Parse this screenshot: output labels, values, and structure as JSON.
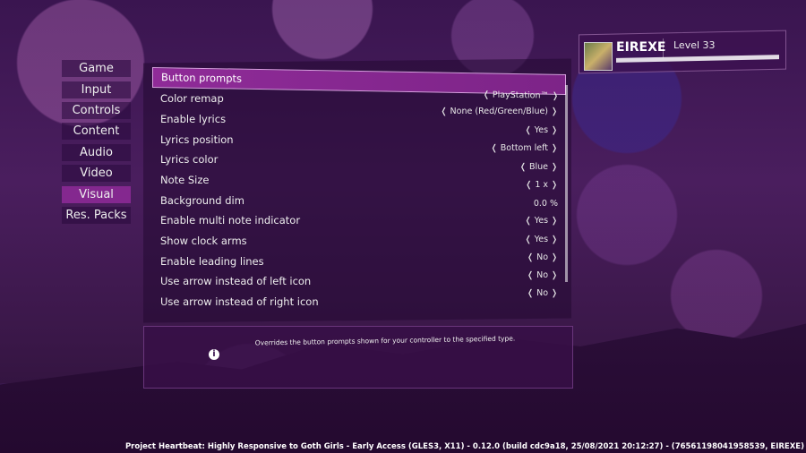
{
  "tabs": [
    {
      "label": "Game"
    },
    {
      "label": "Input"
    },
    {
      "label": "Controls"
    },
    {
      "label": "Content"
    },
    {
      "label": "Audio"
    },
    {
      "label": "Video"
    },
    {
      "label": "Visual",
      "active": true
    },
    {
      "label": "Res. Packs"
    }
  ],
  "settings": [
    {
      "label": "Button prompts",
      "value": "❬ PlayStation™ ❭",
      "selected": true
    },
    {
      "label": "Color remap",
      "value": "❬ None (Red/Green/Blue) ❭"
    },
    {
      "label": "Enable lyrics",
      "value": "❬ Yes ❭"
    },
    {
      "label": "Lyrics position",
      "value": "❬ Bottom left ❭"
    },
    {
      "label": "Lyrics color",
      "value": "❬ Blue ❭"
    },
    {
      "label": "Note Size",
      "value": "❬ 1 x ❭"
    },
    {
      "label": "Background dim",
      "value": "0.0 %"
    },
    {
      "label": "Enable multi note indicator",
      "value": "❬ Yes ❭"
    },
    {
      "label": "Show clock arms",
      "value": "❬ Yes ❭"
    },
    {
      "label": "Enable leading lines",
      "value": "❬ No ❭"
    },
    {
      "label": "Use arrow instead of left icon",
      "value": "❬ No ❭"
    },
    {
      "label": "Use arrow instead of right icon",
      "value": "❬ No ❭"
    }
  ],
  "info": {
    "icon": "i",
    "text": "Overrides the button prompts shown for your controller to the specified type."
  },
  "profile": {
    "username": "EIREXE",
    "level": "Level 33"
  },
  "footer": {
    "build": "Project Heartbeat: Highly Responsive to Goth Girls - Early Access (GLES3, X11) - 0.12.0 (build cdc9a18, 25/08/2021  20:12:27) - (76561198041958539, EIREXE)"
  },
  "colors": {
    "accent": "#84288f",
    "background": "#3a1550"
  }
}
